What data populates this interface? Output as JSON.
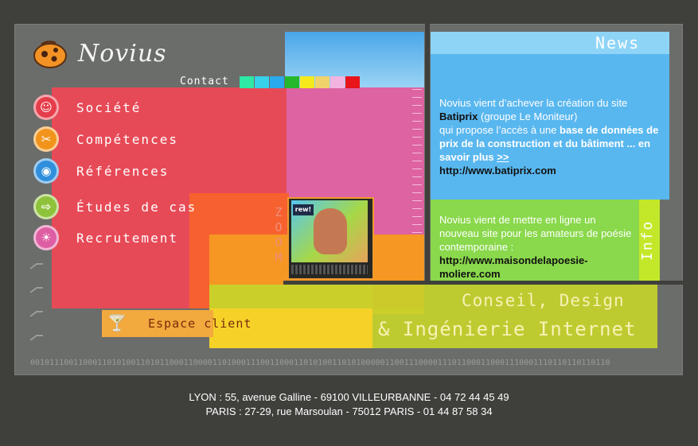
{
  "brand": {
    "name": "Novius",
    "logo_icon": "ladybug-logo-icon"
  },
  "contact": {
    "label": "Contact",
    "swatches": [
      "#2ee8a6",
      "#38d1ea",
      "#2aa9ec",
      "#25b82c",
      "#f6ea1c",
      "#f0d36a",
      "#f3b3e0",
      "#e8141a"
    ]
  },
  "menu": [
    {
      "label": "Société",
      "icon": "people-icon",
      "color": "#e63d4a"
    },
    {
      "label": "Compétences",
      "icon": "scissors-icon",
      "color": "#f2941b"
    },
    {
      "label": "Références",
      "icon": "eye-icon",
      "color": "#2f8fdc"
    },
    {
      "label": "Études de cas",
      "icon": "arrow-right-icon",
      "color": "#8fc23b"
    },
    {
      "label": "Recrutement",
      "icon": "sun-icon",
      "color": "#de5ea3"
    }
  ],
  "espace_client": {
    "label": "Espace client",
    "icon": "cocktail-glass-icon"
  },
  "zoom": {
    "letters": "ZOOM"
  },
  "tv": {
    "logo": "rew!"
  },
  "news": {
    "title": "News",
    "line1": "Novius vient d’achever la création du site",
    "link_name": "Batiprix",
    "group": " (groupe Le Moniteur)",
    "line3": "qui propose l’accès à une ",
    "emph": "base de données de prix de la construction et du bâtiment ... en savoir plus ",
    "more": ">>",
    "url": "http://www.batiprix.com"
  },
  "info": {
    "tab": "Info",
    "text": "Novius vient de mettre en ligne un nouveau site pour les amateurs de poésie contemporaine :",
    "url": "http://www.maisondelapoesie-moliere.com"
  },
  "tagline": {
    "line1": "Conseil, Design",
    "line2": "& Ingénierie Internet"
  },
  "binary": "0010111001100011010100110101100011000011010001110011000110101001101010000011001110000111011000110001110001110110110110110",
  "footer": {
    "lyon": "LYON : 55, avenue Galline - 69100 VILLEURBANNE - 04 72 44 45 49",
    "paris": "PARIS : 27-29, rue Marsoulan - 75012 PARIS - 01 44 87 58 34"
  }
}
